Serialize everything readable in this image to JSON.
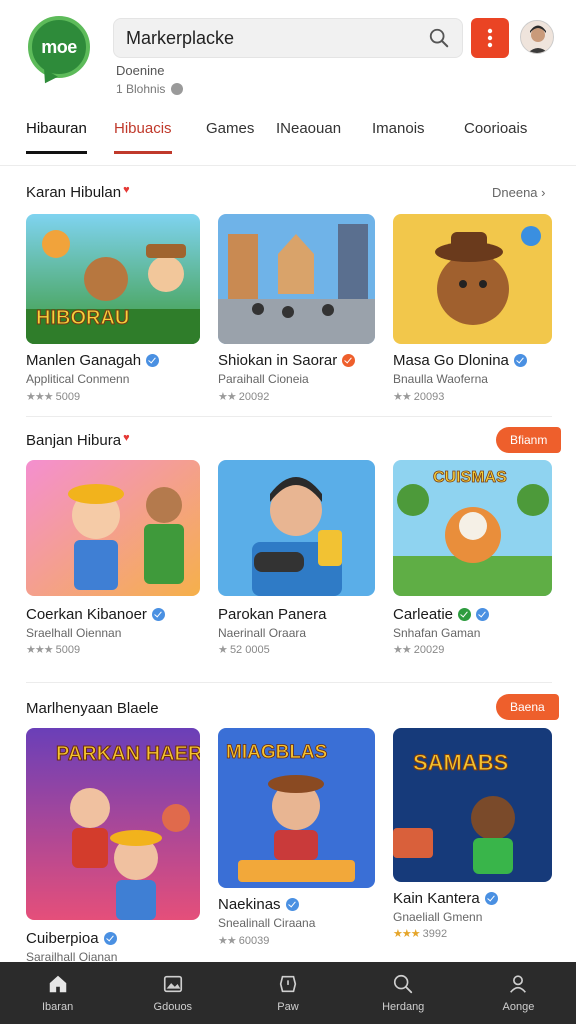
{
  "header": {
    "logo_text": "moe",
    "search_value": "Markerplacke",
    "sub_line1": "Doenine",
    "sub_line2": "1 Blohnis",
    "accent_color": "#ea4424"
  },
  "tabs": [
    "Hibauran",
    "Hibuacis",
    "Games",
    "INeaouan",
    "Imanois",
    "Coorioais"
  ],
  "sections": [
    {
      "title": "Karan Hibulan",
      "action": "Dneena",
      "cards": [
        {
          "title": "Manlen Ganagah",
          "sub": "Applitical Conmenn",
          "meta": "5009",
          "art": "HIBORAU"
        },
        {
          "title": "Shiokan in Saorar",
          "sub": "Paraihall Cioneia",
          "meta": "20092",
          "art": ""
        },
        {
          "title": "Masa Go Dlonina",
          "sub": "Bnaulla Waoferna",
          "meta": "20093",
          "art": ""
        }
      ]
    },
    {
      "title": "Banjan Hibura",
      "action": "Bfianm",
      "cards": [
        {
          "title": "Coerkan Kibanoer",
          "sub": "Sraelhall Oiennan",
          "meta": "5009",
          "art": ""
        },
        {
          "title": "Parokan Panera",
          "sub": "Naerinall Oraara",
          "meta": "52 0005",
          "art": ""
        },
        {
          "title": "Carleatie",
          "sub": "Snhafan Gaman",
          "meta": "20029",
          "art": "CUISMAS"
        }
      ]
    },
    {
      "title": "Marlhenyaan Blaele",
      "action": "Baena",
      "cards": [
        {
          "title": "Cuiberpioa",
          "sub": "Sarailhall Oianan",
          "meta": "",
          "art": "PARKAN HAERS"
        },
        {
          "title": "Naekinas",
          "sub": "Snealinall Ciraana",
          "meta": "60039",
          "art": "MIAGBLAS"
        },
        {
          "title": "Kain Kantera",
          "sub": "Gnaeliall Gmenn",
          "meta": "3992",
          "art": "SAMABS"
        }
      ]
    }
  ],
  "bottom_nav": [
    {
      "label": "Ibaran",
      "icon": "home-icon"
    },
    {
      "label": "Gdouos",
      "icon": "image-icon"
    },
    {
      "label": "Paw",
      "icon": "timer-icon"
    },
    {
      "label": "Herdang",
      "icon": "search-icon"
    },
    {
      "label": "Aonge",
      "icon": "profile-icon"
    }
  ]
}
